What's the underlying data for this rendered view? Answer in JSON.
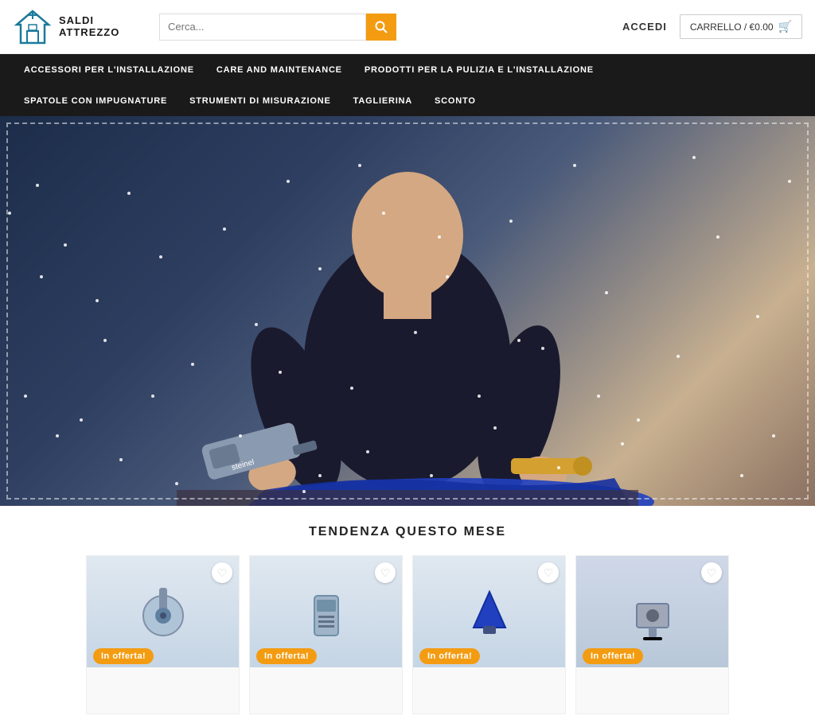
{
  "header": {
    "logo_text_line1": "SALDI",
    "logo_text_line2": "ATTREZZO",
    "search_placeholder": "Cerca...",
    "search_label": "Cerca",
    "accedi_label": "ACCEDI",
    "cart_label": "CARRELLO / €0.00"
  },
  "nav": {
    "row1": [
      {
        "label": "ACCESSORI PER L'INSTALLAZIONE"
      },
      {
        "label": "CARE AND MAINTENANCE"
      },
      {
        "label": "PRODOTTI PER LA PULIZIA E L'INSTALLAZIONE"
      }
    ],
    "row2": [
      {
        "label": "SPATOLE CON IMPUGNATURE"
      },
      {
        "label": "STRUMENTI DI MISURAZIONE"
      },
      {
        "label": "TAGLIERINA"
      },
      {
        "label": "SCONTO"
      }
    ]
  },
  "trending": {
    "title": "TENDENZA QUESTO MESE"
  },
  "products": [
    {
      "offer": "In offerta!",
      "name": ""
    },
    {
      "offer": "In offerta!",
      "name": ""
    },
    {
      "offer": "In offerta!",
      "name": ""
    },
    {
      "offer": "In offerta!",
      "name": ""
    }
  ],
  "colors": {
    "nav_bg": "#1a1a1a",
    "accent_orange": "#f39c12",
    "white": "#ffffff"
  }
}
